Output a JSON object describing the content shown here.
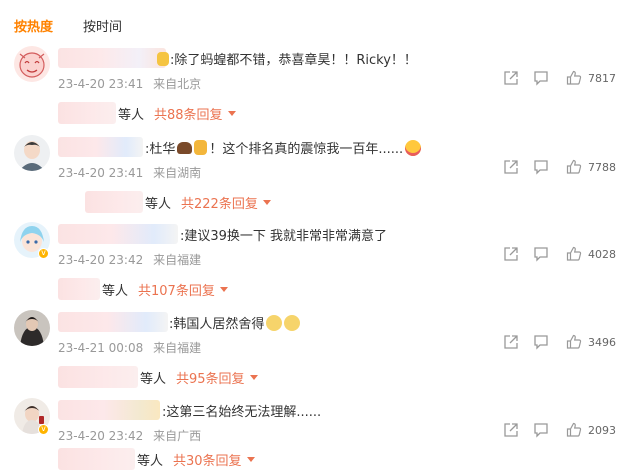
{
  "tabs": [
    {
      "label": "按热度",
      "active": true
    },
    {
      "label": "按时间",
      "active": false
    }
  ],
  "comments": [
    {
      "text": ":除了蚂蝗都不错，恭喜章昊！！Ricky！！",
      "time": "23-4-20 23:41",
      "location": "来自北京",
      "likes": "7817",
      "reply_suffix": "等人",
      "reply_count": "共88条回复"
    },
    {
      "text_before": ":杜华",
      "text_after": "！这个排名真的震惊我一百年......",
      "time": "23-4-20 23:41",
      "location": "来自湖南",
      "likes": "7788",
      "reply_suffix": "等人",
      "reply_count": "共222条回复"
    },
    {
      "text": ":建议39换一下 我就非常非常满意了",
      "time": "23-4-20 23:42",
      "location": "来自福建",
      "likes": "4028",
      "reply_suffix": "等人",
      "reply_count": "共107条回复"
    },
    {
      "text": ":韩国人居然舍得",
      "time": "23-4-21 00:08",
      "location": "来自福建",
      "likes": "3496",
      "reply_suffix": "等人",
      "reply_count": "共95条回复"
    },
    {
      "text": ":这第三名始终无法理解......",
      "time": "23-4-20 23:42",
      "location": "来自广西",
      "likes": "2093",
      "reply_suffix": "等人",
      "reply_count": "共30条回复"
    }
  ],
  "icons": {
    "share": "share-icon",
    "comment": "comment-icon",
    "like": "like-icon",
    "dropdown": "triangle-down-icon"
  },
  "colors": {
    "active_tab": "#ff8200",
    "reply_link": "#eb7350",
    "meta_text": "#999999"
  }
}
